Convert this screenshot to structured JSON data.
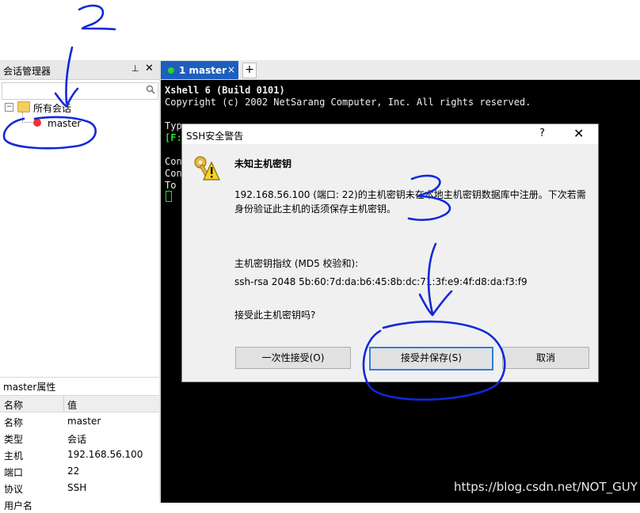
{
  "session_manager": {
    "title": "会话管理器",
    "pin_glyph": "⊥",
    "close_glyph": "✕",
    "tree_root": "所有会话",
    "tree_child": "master"
  },
  "properties": {
    "title": "master属性",
    "col_name": "名称",
    "col_value": "值",
    "rows": [
      {
        "key": "名称",
        "value": "master"
      },
      {
        "key": "类型",
        "value": "会话"
      },
      {
        "key": "主机",
        "value": "192.168.56.100"
      },
      {
        "key": "端口",
        "value": "22"
      },
      {
        "key": "协议",
        "value": "SSH"
      },
      {
        "key": "用户名",
        "value": ""
      }
    ]
  },
  "tabs": {
    "active_label": "1 master",
    "close_glyph": "×",
    "add_glyph": "+"
  },
  "terminal": {
    "line1": "Xshell 6 (Build 0101)",
    "line2": "Copyright (c) 2002 NetSarang Computer, Inc. All rights reserved.",
    "line3": "Typ",
    "line4": "[F:",
    "line5": "Con",
    "line6": "Con",
    "line7": "To "
  },
  "dialog": {
    "title": "SSH安全警告",
    "help_glyph": "?",
    "close_glyph": "✕",
    "heading": "未知主机密钥",
    "message": "192.168.56.100 (端口: 22)的主机密钥未在本地主机密钥数据库中注册。下次若需身份验证此主机的话须保存主机密钥。",
    "fingerprint_label": "主机密钥指纹 (MD5 校验和):",
    "fingerprint_value": "ssh-rsa 2048 5b:60:7d:da:b6:45:8b:dc:71:3f:e9:4f:d8:da:f3:f9",
    "question": "接受此主机密钥吗?",
    "btn_once": "一次性接受(O)",
    "btn_save": "接受并保存(S)",
    "btn_cancel": "取消"
  },
  "watermark": "https://blog.csdn.net/NOT_GUY",
  "colors": {
    "tab_active": "#1e5ebd",
    "terminal_bg": "#000000",
    "annotation_ink": "#1029d8"
  }
}
